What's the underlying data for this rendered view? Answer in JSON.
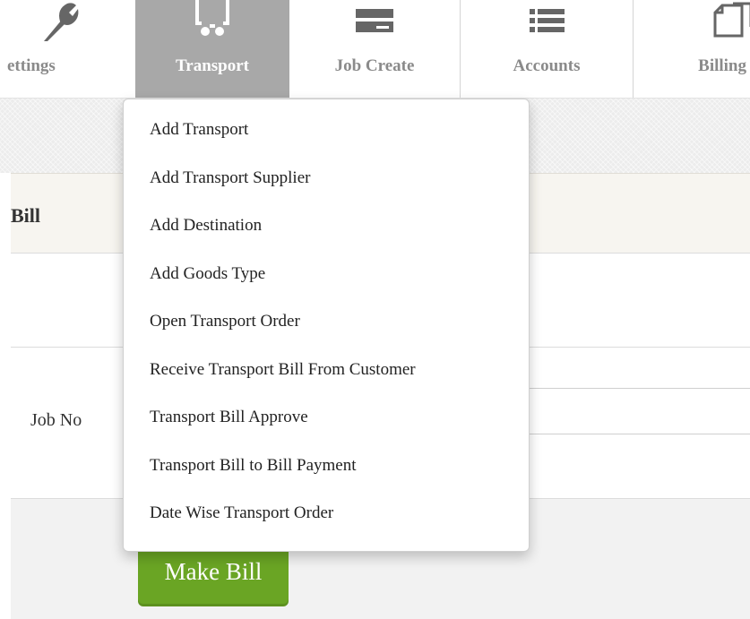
{
  "nav": {
    "items": [
      {
        "label": "ettings",
        "icon": "wrench-icon"
      },
      {
        "label": "Transport",
        "icon": "truck-icon",
        "active": true
      },
      {
        "label": "Job Create",
        "icon": "server-icon"
      },
      {
        "label": "Accounts",
        "icon": "list-icon"
      },
      {
        "label": "Billing",
        "icon": "copy-icon"
      }
    ]
  },
  "page": {
    "bill_title": "Bill",
    "job_no_label": "Job No",
    "make_bill_label": "Make Bill"
  },
  "dropdown": {
    "items": [
      "Add Transport",
      "Add Transport Supplier",
      "Add Destination",
      "Add Goods Type",
      "Open Transport Order",
      "Receive Transport Bill From Customer",
      "Transport Bill Approve",
      "Transport Bill to Bill Payment",
      "Date Wise Transport Order"
    ]
  },
  "colors": {
    "active_tab": "#a8a8a8",
    "button_green": "#6aa524",
    "nav_text": "#8a8a8a",
    "icon": "#666666"
  }
}
